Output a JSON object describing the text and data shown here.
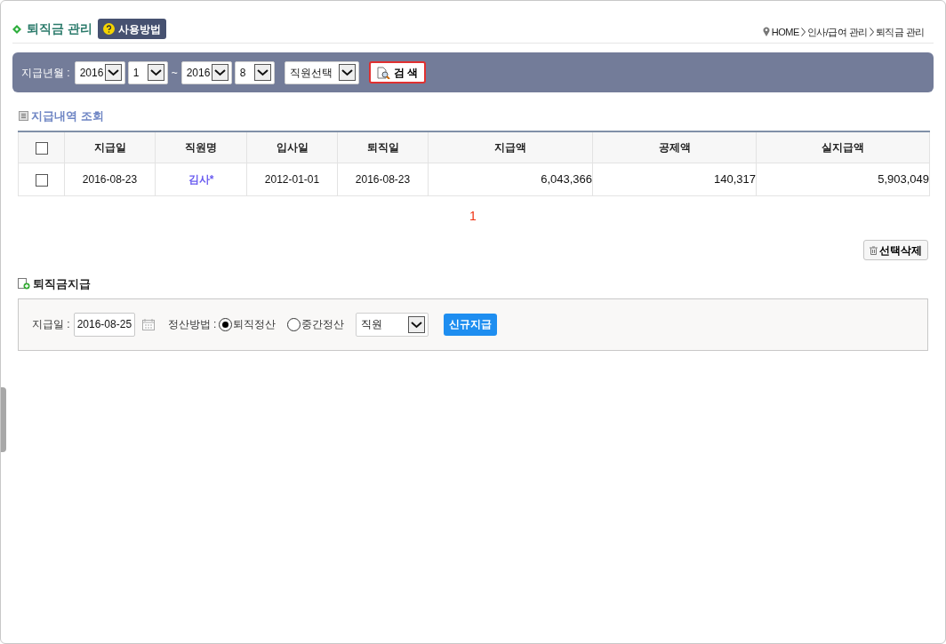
{
  "page_title": "퇴직금 관리",
  "help_button": "사용방법",
  "breadcrumb": [
    "HOME",
    "인사/급여 관리",
    "퇴직금 관리"
  ],
  "search": {
    "label": "지급년월 :",
    "from_year": "2016",
    "from_month": "1",
    "separator": "~",
    "to_year": "2016",
    "to_month": "8",
    "employee": "직원선택",
    "button": "검 색"
  },
  "list_title": "지급내역 조회",
  "table": {
    "columns": [
      "지급일",
      "직원명",
      "입사일",
      "퇴직일",
      "지급액",
      "공제액",
      "실지급액"
    ],
    "header_checked": false,
    "rows": [
      {
        "checked": false,
        "cells": [
          "2016-08-23",
          "김사*",
          "2012-01-01",
          "2016-08-23",
          "6,043,366",
          "140,317",
          "5,903,049"
        ]
      }
    ]
  },
  "pagination": [
    {
      "label": "1",
      "selected": true
    }
  ],
  "delete_button": "선택삭제",
  "payment_title": "퇴직금지급",
  "payment": {
    "date_label": "지급일 :",
    "date": "2016-08-25",
    "method_label": "정산방법 :",
    "methods": [
      {
        "label": "퇴직정산",
        "selected": true
      },
      {
        "label": "중간정산",
        "selected": false
      }
    ],
    "employee": "직원",
    "button": "신규지급"
  }
}
